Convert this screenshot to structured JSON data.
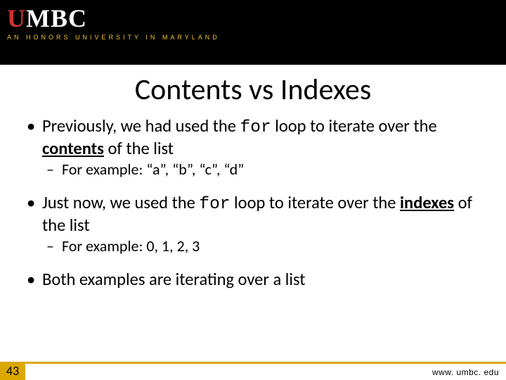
{
  "header": {
    "logo_text": "UMBC",
    "tagline": "AN HONORS UNIVERSITY IN MARYLAND"
  },
  "slide": {
    "title": "Contents vs Indexes",
    "bullets": [
      {
        "pre": "Previously, we had used the ",
        "code": "for",
        "mid": " loop to iterate over the ",
        "emph": "contents",
        "post": " of the list",
        "sub": "For example: “a”, “b”, “c”, “d”"
      },
      {
        "pre": "Just now, we used the ",
        "code": "for",
        "mid": " loop to iterate over the ",
        "emph": "indexes",
        "post": " of the list",
        "sub": "For example: 0, 1, 2, 3"
      },
      {
        "pre": "Both examples are iterating over a list",
        "code": "",
        "mid": "",
        "emph": "",
        "post": "",
        "sub": ""
      }
    ]
  },
  "footer": {
    "page_number": "43",
    "url": "www. umbc. edu"
  }
}
